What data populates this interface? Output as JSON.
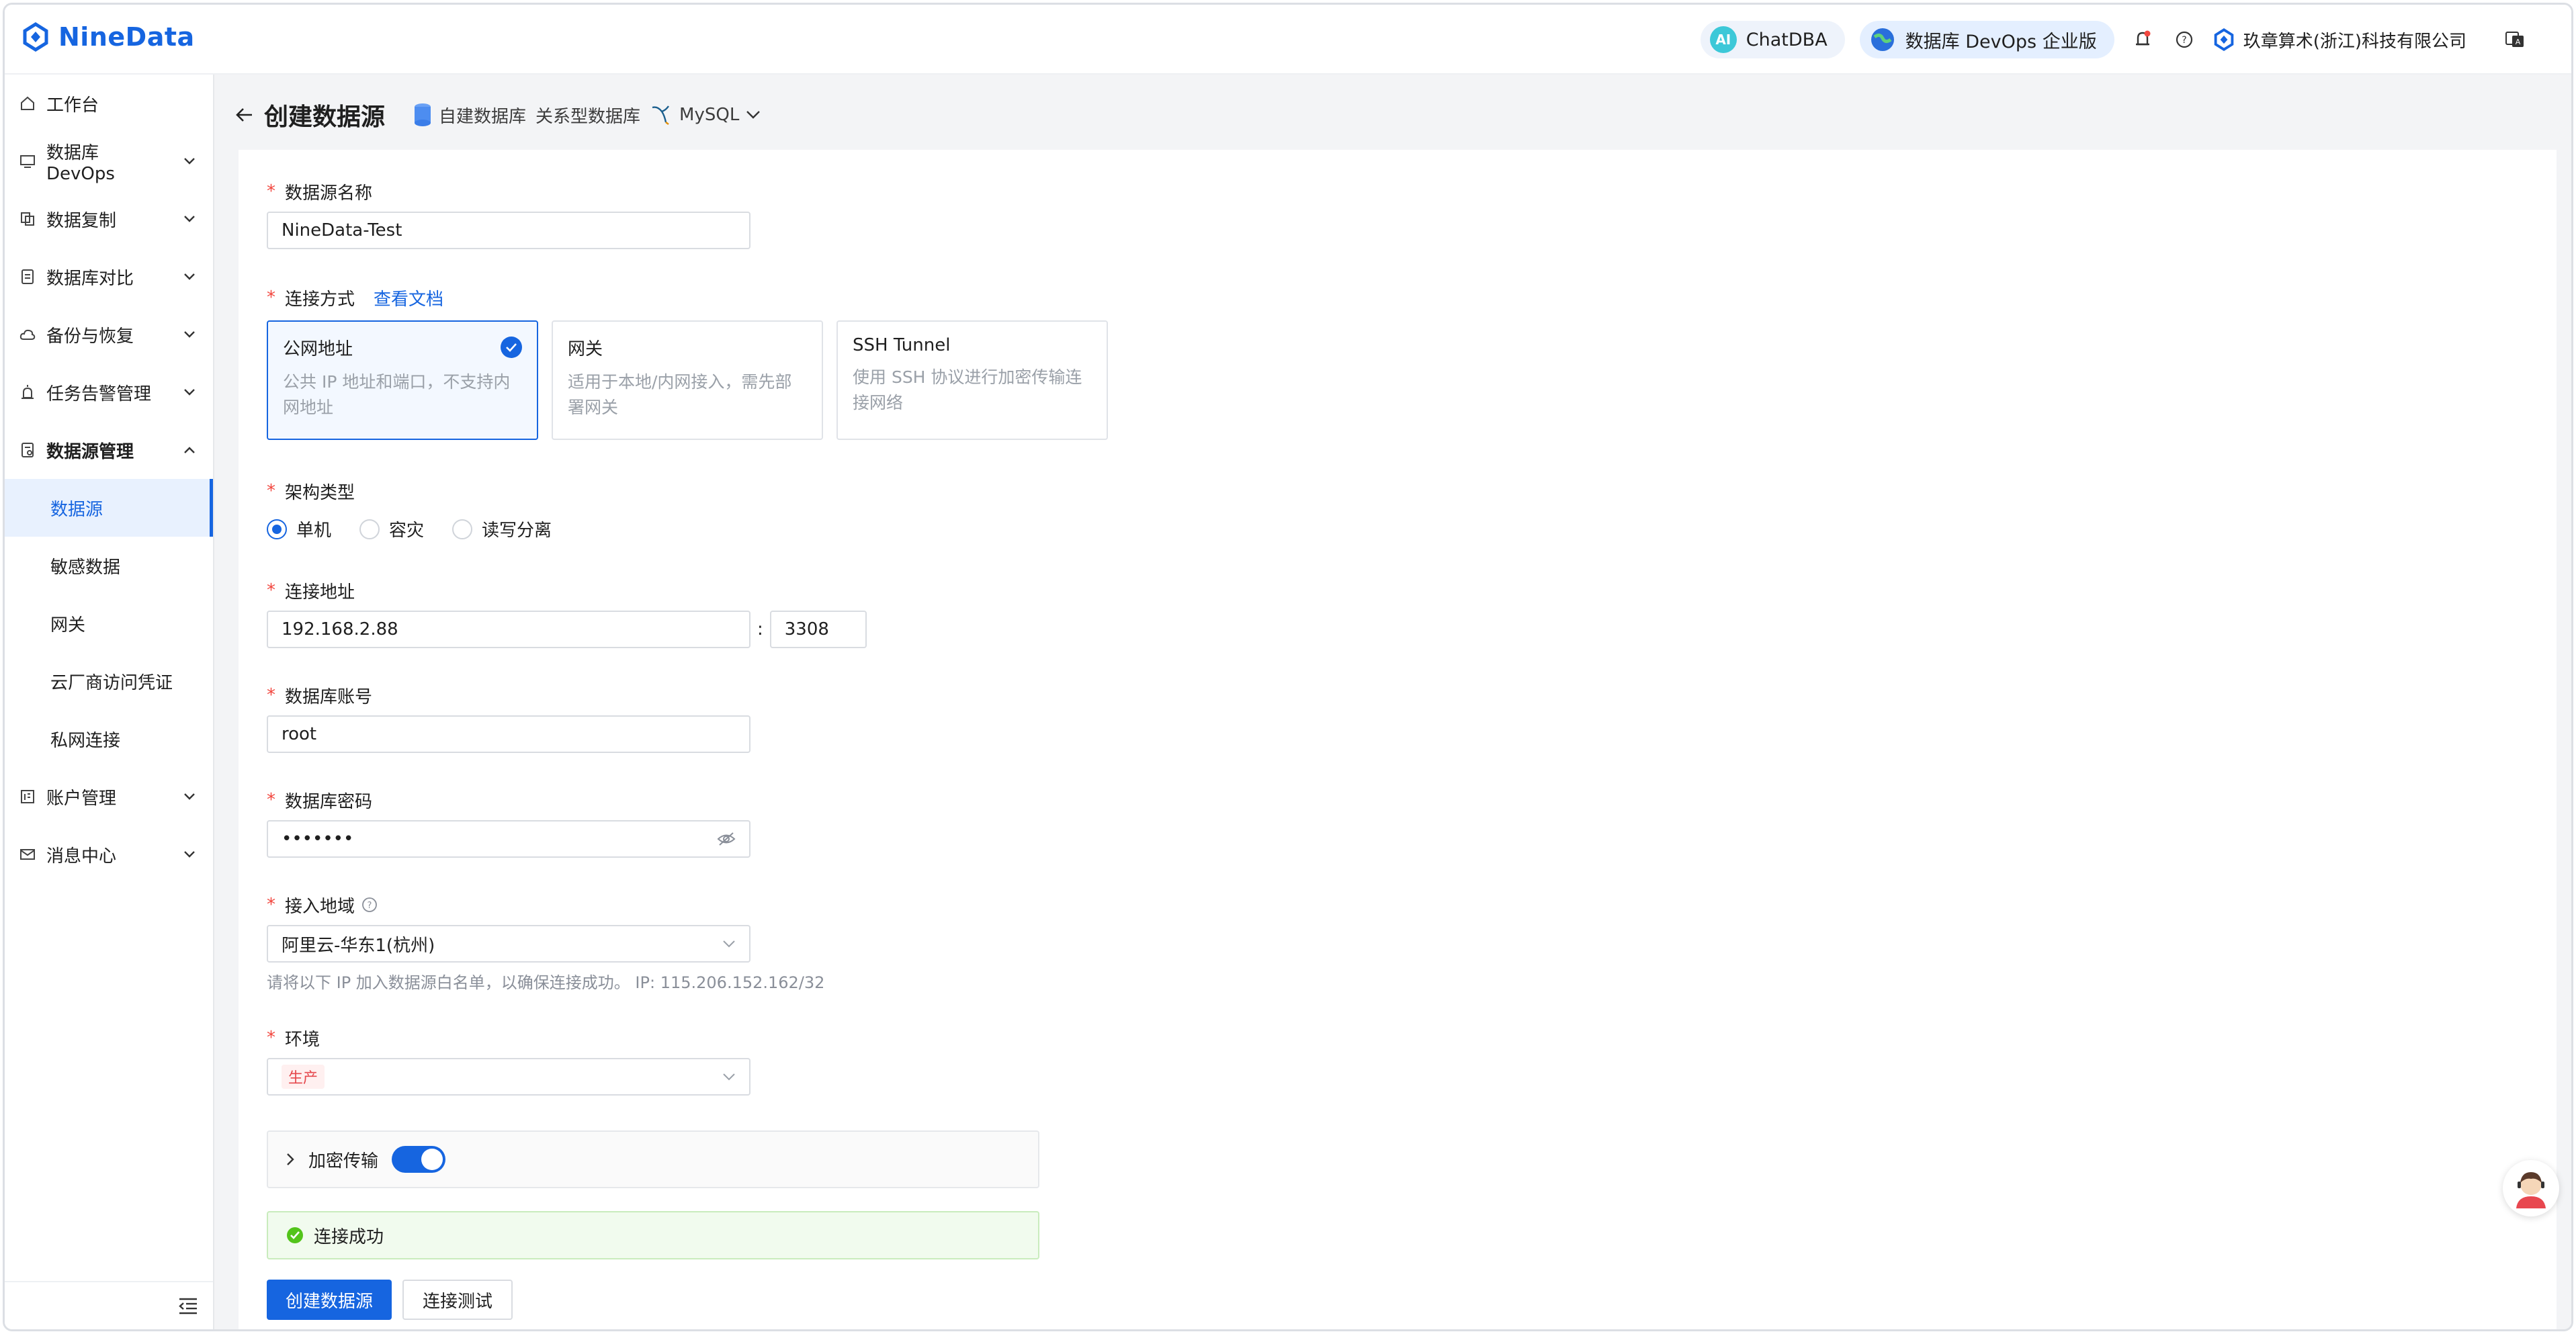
{
  "app": {
    "name": "NineData"
  },
  "topbar": {
    "chatdba_label": "ChatDBA",
    "chatdba_badge": "AI",
    "edition_label": "数据库 DevOps 企业版",
    "company_name": "玖章算术(浙江)科技有限公司"
  },
  "sidebar": {
    "items": [
      {
        "label": "工作台",
        "icon": "home-icon"
      },
      {
        "label": "数据库 DevOps",
        "icon": "monitor-icon"
      },
      {
        "label": "数据复制",
        "icon": "copy-icon"
      },
      {
        "label": "数据库对比",
        "icon": "compare-icon"
      },
      {
        "label": "备份与恢复",
        "icon": "cloud-icon"
      },
      {
        "label": "任务告警管理",
        "icon": "alarm-icon"
      },
      {
        "label": "数据源管理",
        "icon": "datasource-icon"
      },
      {
        "label": "账户管理",
        "icon": "account-icon"
      },
      {
        "label": "消息中心",
        "icon": "mail-icon"
      }
    ],
    "sub_items": [
      "数据源",
      "敏感数据",
      "网关",
      "云厂商访问凭证",
      "私网连接"
    ]
  },
  "page": {
    "title": "创建数据源",
    "crumb_source": "自建数据库",
    "crumb_type": "关系型数据库",
    "crumb_engine": "MySQL"
  },
  "form": {
    "name": {
      "label": "数据源名称",
      "value": "NineData-Test"
    },
    "connection": {
      "label": "连接方式",
      "doc_link": "查看文档",
      "options": [
        {
          "title": "公网地址",
          "desc1": "公共 IP 地址和端口，不支持内",
          "desc2": "网地址"
        },
        {
          "title": "网关",
          "desc1": "适用于本地/内网接入，需先部",
          "desc2": "署网关"
        },
        {
          "title": "SSH Tunnel",
          "desc1": "使用 SSH 协议进行加密传输连",
          "desc2": "接网络"
        }
      ]
    },
    "arch": {
      "label": "架构类型",
      "options": [
        "单机",
        "容灾",
        "读写分离"
      ]
    },
    "address": {
      "label": "连接地址",
      "host": "192.168.2.88",
      "sep": ":",
      "port": "3308"
    },
    "account": {
      "label": "数据库账号",
      "value": "root"
    },
    "password": {
      "label": "数据库密码",
      "value": "•••••••"
    },
    "region": {
      "label": "接入地域",
      "value": "阿里云-华东1(杭州)",
      "hint": "请将以下 IP 加入数据源白名单，以确保连接成功。 IP: 115.206.152.162/32"
    },
    "env": {
      "label": "环境",
      "value": "生产"
    },
    "encrypt": {
      "label": "加密传输"
    },
    "status": "连接成功",
    "create_button": "创建数据源",
    "test_button": "连接测试"
  },
  "colors": {
    "primary": "#1665e0",
    "required": "#f2473f",
    "success": "#52c41a"
  }
}
